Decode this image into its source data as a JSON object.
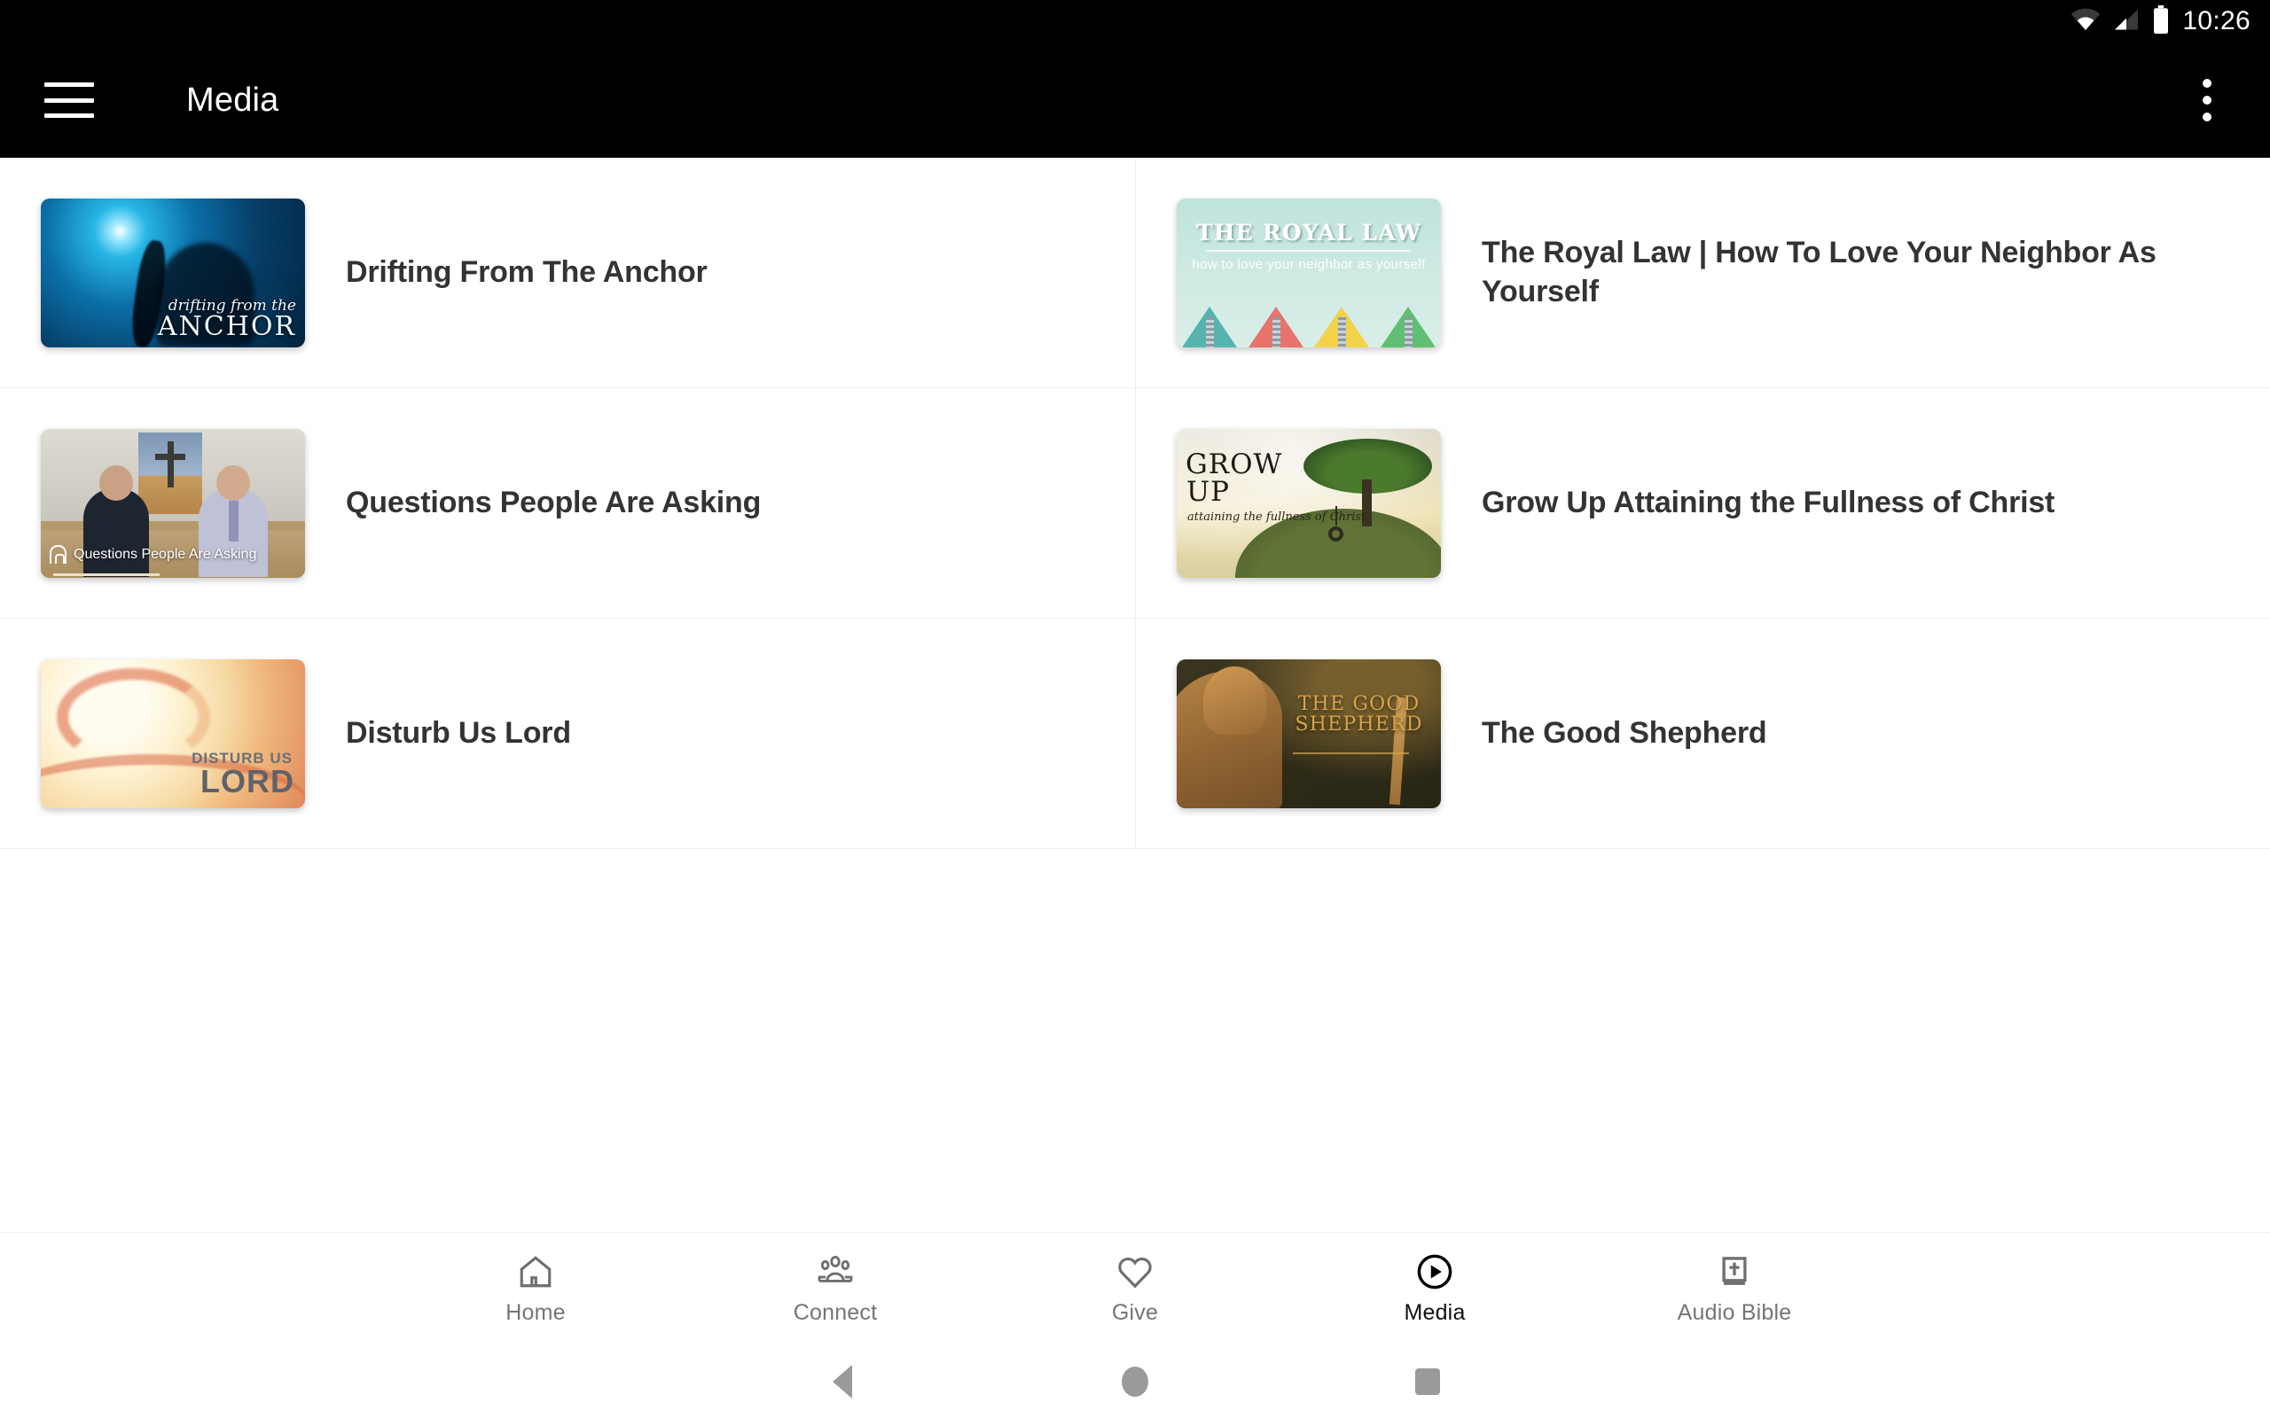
{
  "status_bar": {
    "time": "10:26",
    "icons": [
      "wifi-icon",
      "cellular-signal-icon",
      "battery-icon"
    ]
  },
  "app_bar": {
    "menu_icon": "hamburger-menu-icon",
    "title": "Media",
    "overflow_icon": "more-vert-icon"
  },
  "media_items": [
    {
      "title": "Drifting From The Anchor",
      "thumb_art": "art-anchor",
      "thumb_text": {
        "script": "drifting from the",
        "main": "ANCHOR"
      }
    },
    {
      "title": "The Royal Law | How To Love Your Neighbor As Yourself",
      "thumb_art": "art-royal",
      "thumb_text": {
        "main": "THE ROYAL LAW",
        "sub": "how to love your neighbor as yourself"
      }
    },
    {
      "title": "Questions People Are Asking",
      "thumb_art": "art-questions",
      "thumb_text": {
        "overlay": "Questions People Are Asking"
      }
    },
    {
      "title": "Grow Up Attaining the Fullness of Christ",
      "thumb_art": "art-grow",
      "thumb_text": {
        "line1": "GROW",
        "line2": "UP",
        "sub": "attaining the fullness of Christ"
      }
    },
    {
      "title": "Disturb Us Lord",
      "thumb_art": "art-disturb",
      "thumb_text": {
        "line1": "DISTURB US",
        "line2": "LORD"
      }
    },
    {
      "title": "The Good Shepherd",
      "thumb_art": "art-shepherd",
      "thumb_text": {
        "main": "THE GOOD SHEPHERD"
      }
    }
  ],
  "bottom_nav": {
    "items": [
      {
        "label": "Home",
        "icon": "home-icon",
        "active": false
      },
      {
        "label": "Connect",
        "icon": "people-group-icon",
        "active": false
      },
      {
        "label": "Give",
        "icon": "heart-icon",
        "active": false
      },
      {
        "label": "Media",
        "icon": "play-circle-icon",
        "active": true
      },
      {
        "label": "Audio Bible",
        "icon": "bible-book-icon",
        "active": false
      }
    ]
  },
  "android_nav": {
    "back": "back-triangle-icon",
    "home": "home-circle-icon",
    "recents": "recents-square-icon"
  },
  "colors": {
    "app_bar_bg": "#000000",
    "page_bg": "#ffffff",
    "title_text": "#333333",
    "nav_inactive": "#757575",
    "nav_active": "#111111",
    "divider": "#eeeeee"
  }
}
